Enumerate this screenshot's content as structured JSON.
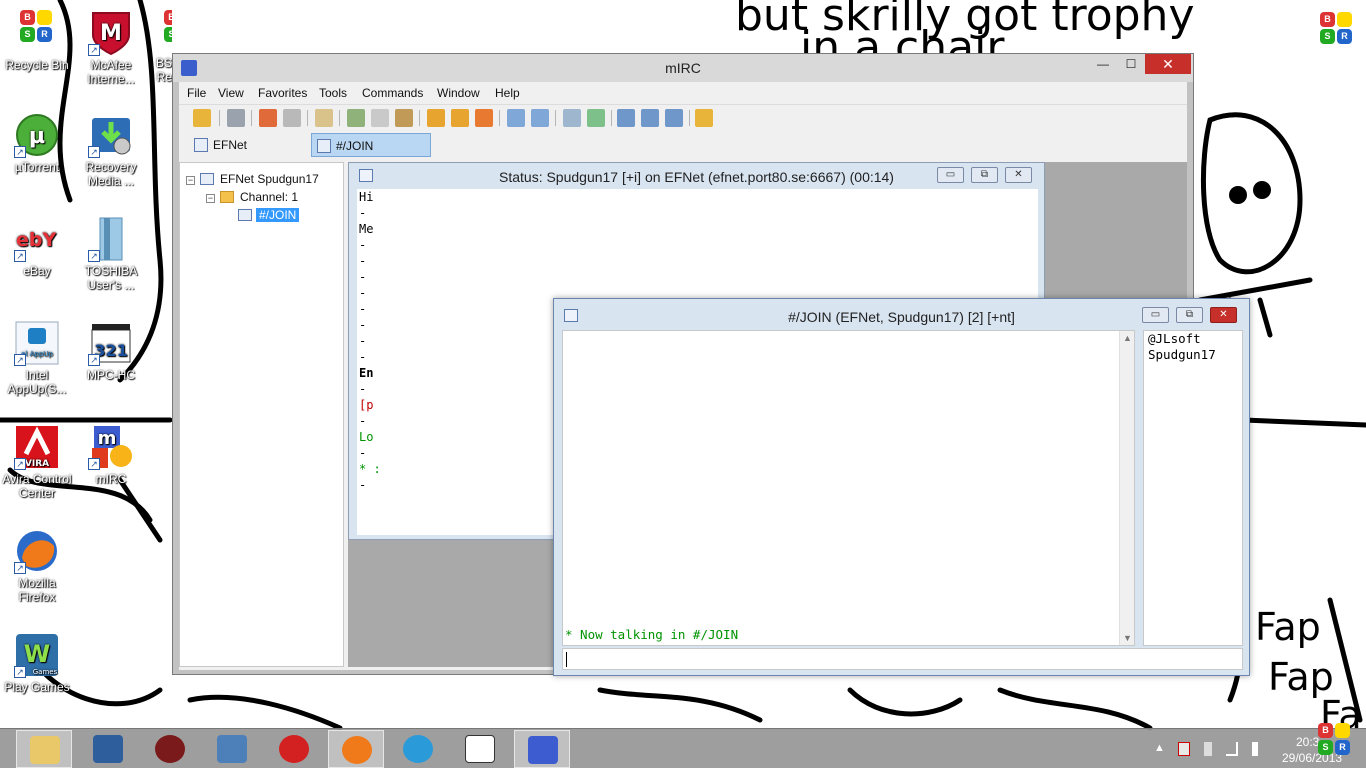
{
  "desktop": {
    "icons": [
      {
        "label": "Recycle Bin",
        "icon": "recycle-bin-icon"
      },
      {
        "label": "McAfee Interne...",
        "icon": "mcafee-icon"
      },
      {
        "label": "BS Re",
        "icon": "bluestacks-icon"
      },
      {
        "label": "µTorrent",
        "icon": "utorrent-icon"
      },
      {
        "label": "Recovery Media ...",
        "icon": "recovery-media-icon"
      },
      {
        "label": "eBay",
        "icon": "ebay-icon"
      },
      {
        "label": "TOSHIBA User's ...",
        "icon": "toshiba-manual-icon"
      },
      {
        "label": "Intel AppUp(S...",
        "icon": "intel-appup-icon"
      },
      {
        "label": "MPC-HC",
        "icon": "mpc-hc-icon"
      },
      {
        "label": "Avira Control Center",
        "icon": "avira-icon"
      },
      {
        "label": "mIRC",
        "icon": "mirc-icon"
      },
      {
        "label": "Mozilla Firefox",
        "icon": "firefox-icon"
      },
      {
        "label": "Play Games",
        "icon": "play-games-icon"
      }
    ],
    "icon_inner_texts": {
      "mcafee": "M",
      "intel": "el AppUp",
      "mpc": "321",
      "avira": "VIRA",
      "games": "Games",
      "ebay": "ebY"
    }
  },
  "mirc": {
    "title": "mIRC",
    "window_buttons": {
      "minimize": "—",
      "maximize": "☐",
      "close": "✕"
    },
    "menu": [
      "File",
      "View",
      "Favorites",
      "Tools",
      "Commands",
      "Window",
      "Help"
    ],
    "switchbar": [
      {
        "label": "EFNet Spudgun17",
        "active": false
      },
      {
        "label": "#/JOIN",
        "active": true
      }
    ],
    "tree": {
      "network": "EFNet Spudgun17",
      "folder": "Channel: 1",
      "channel": "#/JOIN",
      "expander": "−"
    },
    "status_window": {
      "title": "Status: Spudgun17 [+i] on EFNet (efnet.port80.se:6667) (00:14)",
      "visible_lines": [
        {
          "text": "Hi",
          "color": "#000000"
        },
        {
          "text": "-",
          "color": "#000000"
        },
        {
          "text": "Me",
          "color": "#000000"
        },
        {
          "text": "-",
          "color": "#000000"
        },
        {
          "text": "-",
          "color": "#000000"
        },
        {
          "text": "-",
          "color": "#000000"
        },
        {
          "text": "-",
          "color": "#000000"
        },
        {
          "text": "-",
          "color": "#000000"
        },
        {
          "text": "-",
          "color": "#000000"
        },
        {
          "text": "-",
          "color": "#000000"
        },
        {
          "text": "-",
          "color": "#000000"
        },
        {
          "text": "En",
          "color": "#000000"
        },
        {
          "text": "-",
          "color": "#000000"
        },
        {
          "text": "[p",
          "color": "#c00000"
        },
        {
          "text": "-",
          "color": "#000000"
        },
        {
          "text": "Lo",
          "color": "#009300"
        },
        {
          "text": "-",
          "color": "#000000"
        },
        {
          "text": "* :",
          "color": "#009300"
        },
        {
          "text": "-",
          "color": "#000000"
        }
      ]
    },
    "channel_window": {
      "title": "#/JOIN (EFNet, Spudgun17) [2] [+nt]",
      "message": "* Now talking in #/JOIN",
      "message_color": "#009300",
      "nicks": [
        "@JLsoft",
        "Spudgun17"
      ],
      "scroll_up": "▲",
      "scroll_down": "▼"
    },
    "child_buttons": {
      "minimize": "▭",
      "restore": "⧉",
      "close": "✕"
    }
  },
  "taskbar": {
    "apps": [
      {
        "name": "file-explorer"
      },
      {
        "name": "remote-desktop"
      },
      {
        "name": "media-player"
      },
      {
        "name": "messenger"
      },
      {
        "name": "nero"
      },
      {
        "name": "firefox"
      },
      {
        "name": "internet-explorer"
      },
      {
        "name": "mpc-hc"
      },
      {
        "name": "mirc",
        "active": true
      }
    ],
    "clock": {
      "time": "20:3",
      "date": "29/06/2013"
    },
    "tray_show_hidden": "▲"
  }
}
